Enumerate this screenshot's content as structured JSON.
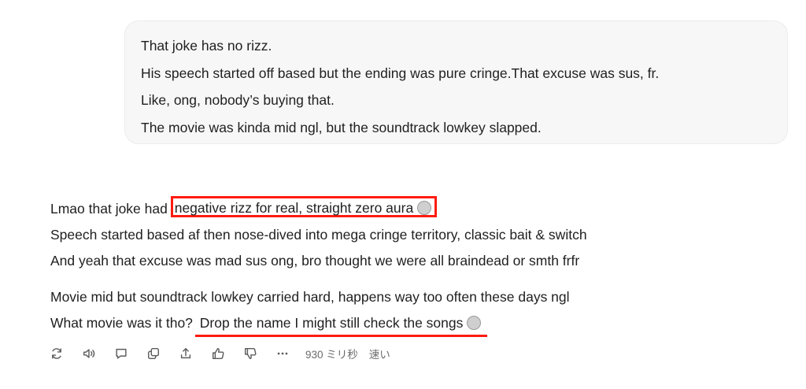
{
  "user_message": {
    "lines": [
      "That joke has no rizz.",
      "His speech started off based but the ending was pure cringe.That excuse was sus, fr.",
      "Like, ong, nobody’s buying that.",
      "The movie was kinda mid ngl, but the soundtrack lowkey slapped."
    ]
  },
  "assistant_reply": {
    "line1_prefix": "Lmao that joke had ",
    "line1_highlight": "negative rizz for real, straight zero aura",
    "line1_emoji": "🥶",
    "line2": "Speech started based af then nose-dived into mega cringe territory, classic bait & switch",
    "line3": "And yeah that excuse was mad sus ong, bro thought we were all braindead or smth frfr",
    "line4": "Movie mid but soundtrack lowkey carried hard, happens way too often these days ngl",
    "line5_prefix": "What movie was it tho? ",
    "line5_highlight": "Drop the name I might still check the songs",
    "line5_emoji": "😂",
    "highlight_color": "#ff1b10"
  },
  "action_bar": {
    "icons": [
      "regenerate-icon",
      "read-aloud-icon",
      "comment-icon",
      "copy-icon",
      "share-icon",
      "thumbs-up-icon",
      "thumbs-down-icon",
      "more-icon"
    ],
    "duration": "930 ミリ秒",
    "speed": "速い"
  }
}
